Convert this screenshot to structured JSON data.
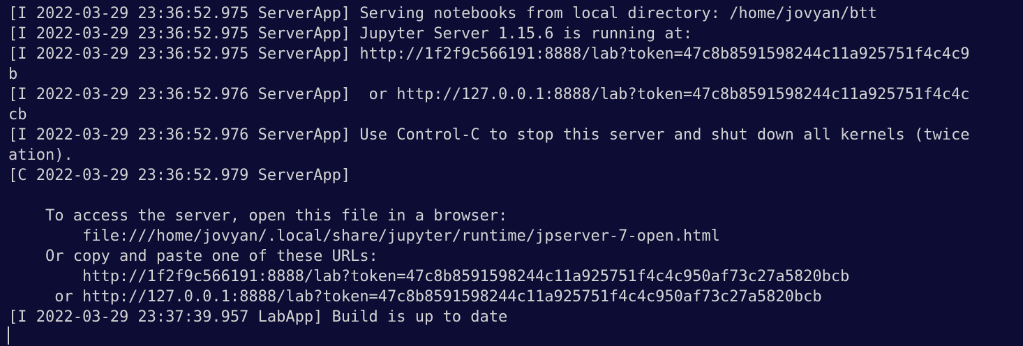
{
  "terminal": {
    "lines": [
      "[I 2022-03-29 23:36:52.975 ServerApp] Serving notebooks from local directory: /home/jovyan/btt",
      "[I 2022-03-29 23:36:52.975 ServerApp] Jupyter Server 1.15.6 is running at:",
      "[I 2022-03-29 23:36:52.975 ServerApp] http://1f2f9c566191:8888/lab?token=47c8b8591598244c11a925751f4c4c9",
      "b",
      "[I 2022-03-29 23:36:52.976 ServerApp]  or http://127.0.0.1:8888/lab?token=47c8b8591598244c11a925751f4c4c",
      "cb",
      "[I 2022-03-29 23:36:52.976 ServerApp] Use Control-C to stop this server and shut down all kernels (twice",
      "ation).",
      "[C 2022-03-29 23:36:52.979 ServerApp]",
      "",
      "    To access the server, open this file in a browser:",
      "        file:///home/jovyan/.local/share/jupyter/runtime/jpserver-7-open.html",
      "    Or copy and paste one of these URLs:",
      "        http://1f2f9c566191:8888/lab?token=47c8b8591598244c11a925751f4c4c950af73c27a5820bcb",
      "     or http://127.0.0.1:8888/lab?token=47c8b8591598244c11a925751f4c4c950af73c27a5820bcb",
      "[I 2022-03-29 23:37:39.957 LabApp] Build is up to date"
    ]
  }
}
